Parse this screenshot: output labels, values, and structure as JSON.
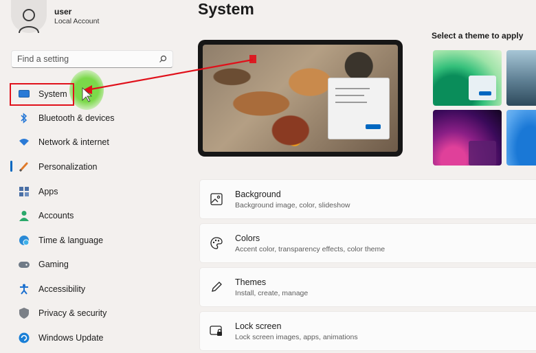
{
  "user": {
    "name": "user",
    "account_type": "Local Account"
  },
  "search": {
    "placeholder": "Find a setting"
  },
  "sidebar": {
    "items": [
      {
        "label": "System",
        "icon": "monitor-icon"
      },
      {
        "label": "Bluetooth & devices",
        "icon": "bluetooth-icon"
      },
      {
        "label": "Network & internet",
        "icon": "wifi-icon"
      },
      {
        "label": "Personalization",
        "icon": "brush-icon"
      },
      {
        "label": "Apps",
        "icon": "apps-icon"
      },
      {
        "label": "Accounts",
        "icon": "person-icon"
      },
      {
        "label": "Time & language",
        "icon": "globe-clock-icon"
      },
      {
        "label": "Gaming",
        "icon": "gamepad-icon"
      },
      {
        "label": "Accessibility",
        "icon": "accessibility-icon"
      },
      {
        "label": "Privacy & security",
        "icon": "shield-icon"
      },
      {
        "label": "Windows Update",
        "icon": "update-icon"
      }
    ]
  },
  "main": {
    "title": "System",
    "theme_heading": "Select a theme to apply",
    "cards": [
      {
        "title": "Background",
        "subtitle": "Background image, color, slideshow",
        "icon": "image-icon"
      },
      {
        "title": "Colors",
        "subtitle": "Accent color, transparency effects, color theme",
        "icon": "palette-icon"
      },
      {
        "title": "Themes",
        "subtitle": "Install, create, manage",
        "icon": "pen-icon"
      },
      {
        "title": "Lock screen",
        "subtitle": "Lock screen images, apps, animations",
        "icon": "lock-screen-icon"
      }
    ]
  },
  "colors": {
    "accent": "#0067c0",
    "annotation_red": "#e0101a",
    "cursor_green": "#7bd94a"
  }
}
